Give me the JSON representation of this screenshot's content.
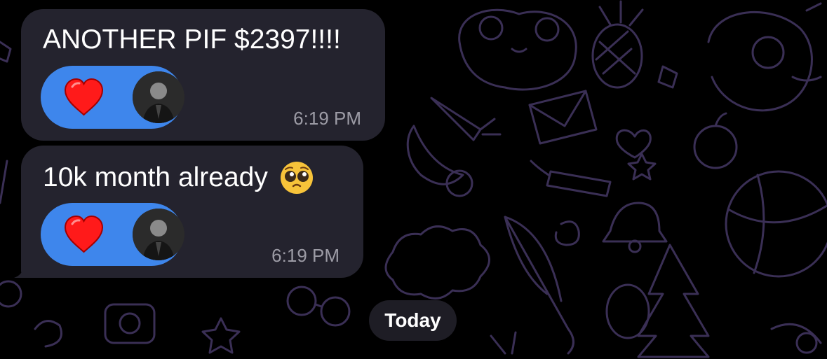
{
  "chat": {
    "messages": [
      {
        "text": "ANOTHER PIF $2397!!!!",
        "emoji": "",
        "reaction": {
          "emoji": "heart",
          "avatar": "user-avatar"
        },
        "time": "6:19 PM"
      },
      {
        "text": "10k month already",
        "emoji": "pleading-face",
        "reaction": {
          "emoji": "heart",
          "avatar": "user-avatar"
        },
        "time": "6:19 PM"
      }
    ],
    "date_separator": "Today"
  },
  "colors": {
    "background": "#000000",
    "bubble": "#24232e",
    "reaction_pill": "#3e86ec",
    "heart": "#ff1a1a",
    "timestamp": "#9c9ba5",
    "wallpaper_doodles": "#3a2f55"
  }
}
